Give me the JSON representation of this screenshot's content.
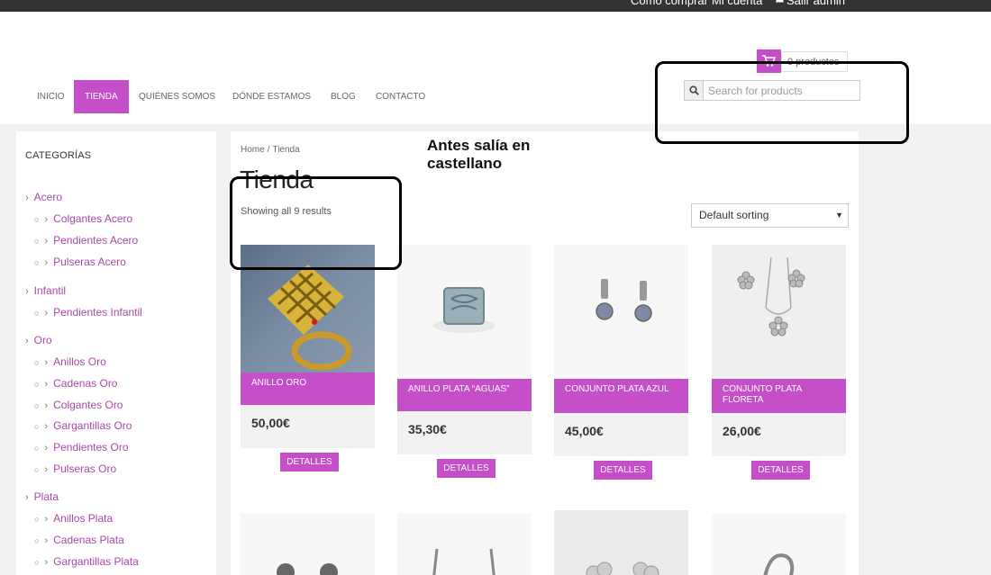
{
  "topbar": {
    "links": [
      "Cómo comprar",
      "Mi cuenta",
      "Salir admin"
    ]
  },
  "cart": {
    "label": "0 productos",
    "icon": "cart-icon"
  },
  "nav": {
    "items": [
      {
        "label": "INICIO",
        "active": false
      },
      {
        "label": "TIENDA",
        "active": true
      },
      {
        "label": "QUIÉNES SOMOS",
        "active": false
      },
      {
        "label": "DÓNDE ESTAMOS",
        "active": false
      },
      {
        "label": "BLOG",
        "active": false
      },
      {
        "label": "CONTACTO",
        "active": false
      }
    ]
  },
  "search": {
    "placeholder": "Search for products",
    "value": ""
  },
  "sidebar": {
    "title": "CATEGORÍAS",
    "categories": [
      {
        "label": "Acero",
        "children": [
          "Colgantes Acero",
          "Pendientes Acero",
          "Pulseras Acero"
        ]
      },
      {
        "label": "Infantil",
        "children": [
          "Pendientes Infantil"
        ]
      },
      {
        "label": "Oro",
        "children": [
          "Anillos Oro",
          "Cadenas Oro",
          "Colgantes Oro",
          "Gargantillas Oro",
          "Pendientes Oro",
          "Pulseras Oro"
        ]
      },
      {
        "label": "Plata",
        "children": [
          "Anillos Plata",
          "Cadenas Plata",
          "Gargantillas Plata"
        ]
      }
    ]
  },
  "main": {
    "breadcrumb": [
      "Home",
      "Tienda"
    ],
    "breadcrumb_sep": "/",
    "title": "Tienda",
    "results": "Showing all 9 results",
    "sorting": "Default sorting",
    "note": [
      "Antes salía en",
      "castellano"
    ],
    "button_label": "DETALLES",
    "products": [
      {
        "name": "ANILLO ORO",
        "price": "50,00€"
      },
      {
        "name": "ANILLO PLATA “AGUAS”",
        "price": "35,30€"
      },
      {
        "name": "CONJUNTO PLATA AZUL",
        "price": "45,00€"
      },
      {
        "name": "CONJUNTO PLATA FLORETA",
        "price": "26,00€"
      }
    ]
  },
  "colors": {
    "accent": "#c44fc9",
    "topbar": "#333333",
    "background": "#f2f2f2"
  }
}
